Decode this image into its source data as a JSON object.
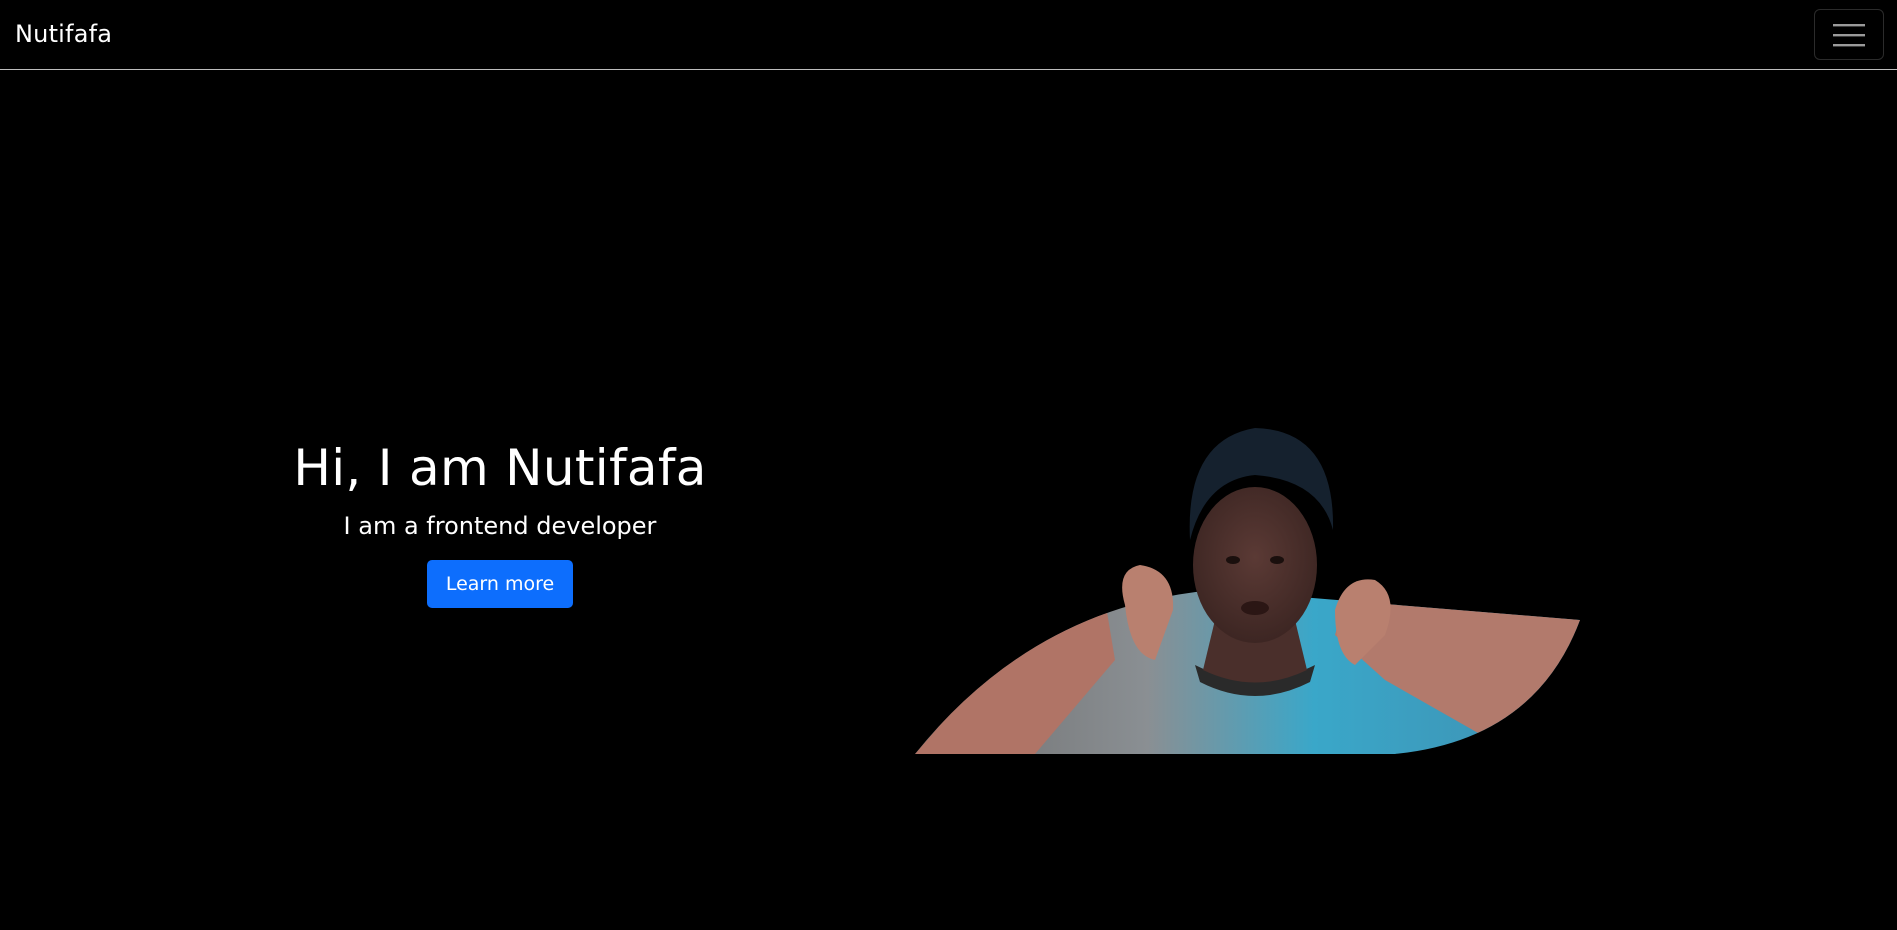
{
  "navbar": {
    "brand": "Nutifafa",
    "menu_icon": "hamburger-menu-icon"
  },
  "hero": {
    "title": "Hi, I am Nutifafa",
    "subtitle": "I am a frontend developer",
    "button_label": "Learn more",
    "photo_alt": "Portrait photo"
  },
  "colors": {
    "background": "#000000",
    "text": "#ffffff",
    "button": "#0d6efd",
    "navbar_border": "#bdbdbd"
  }
}
